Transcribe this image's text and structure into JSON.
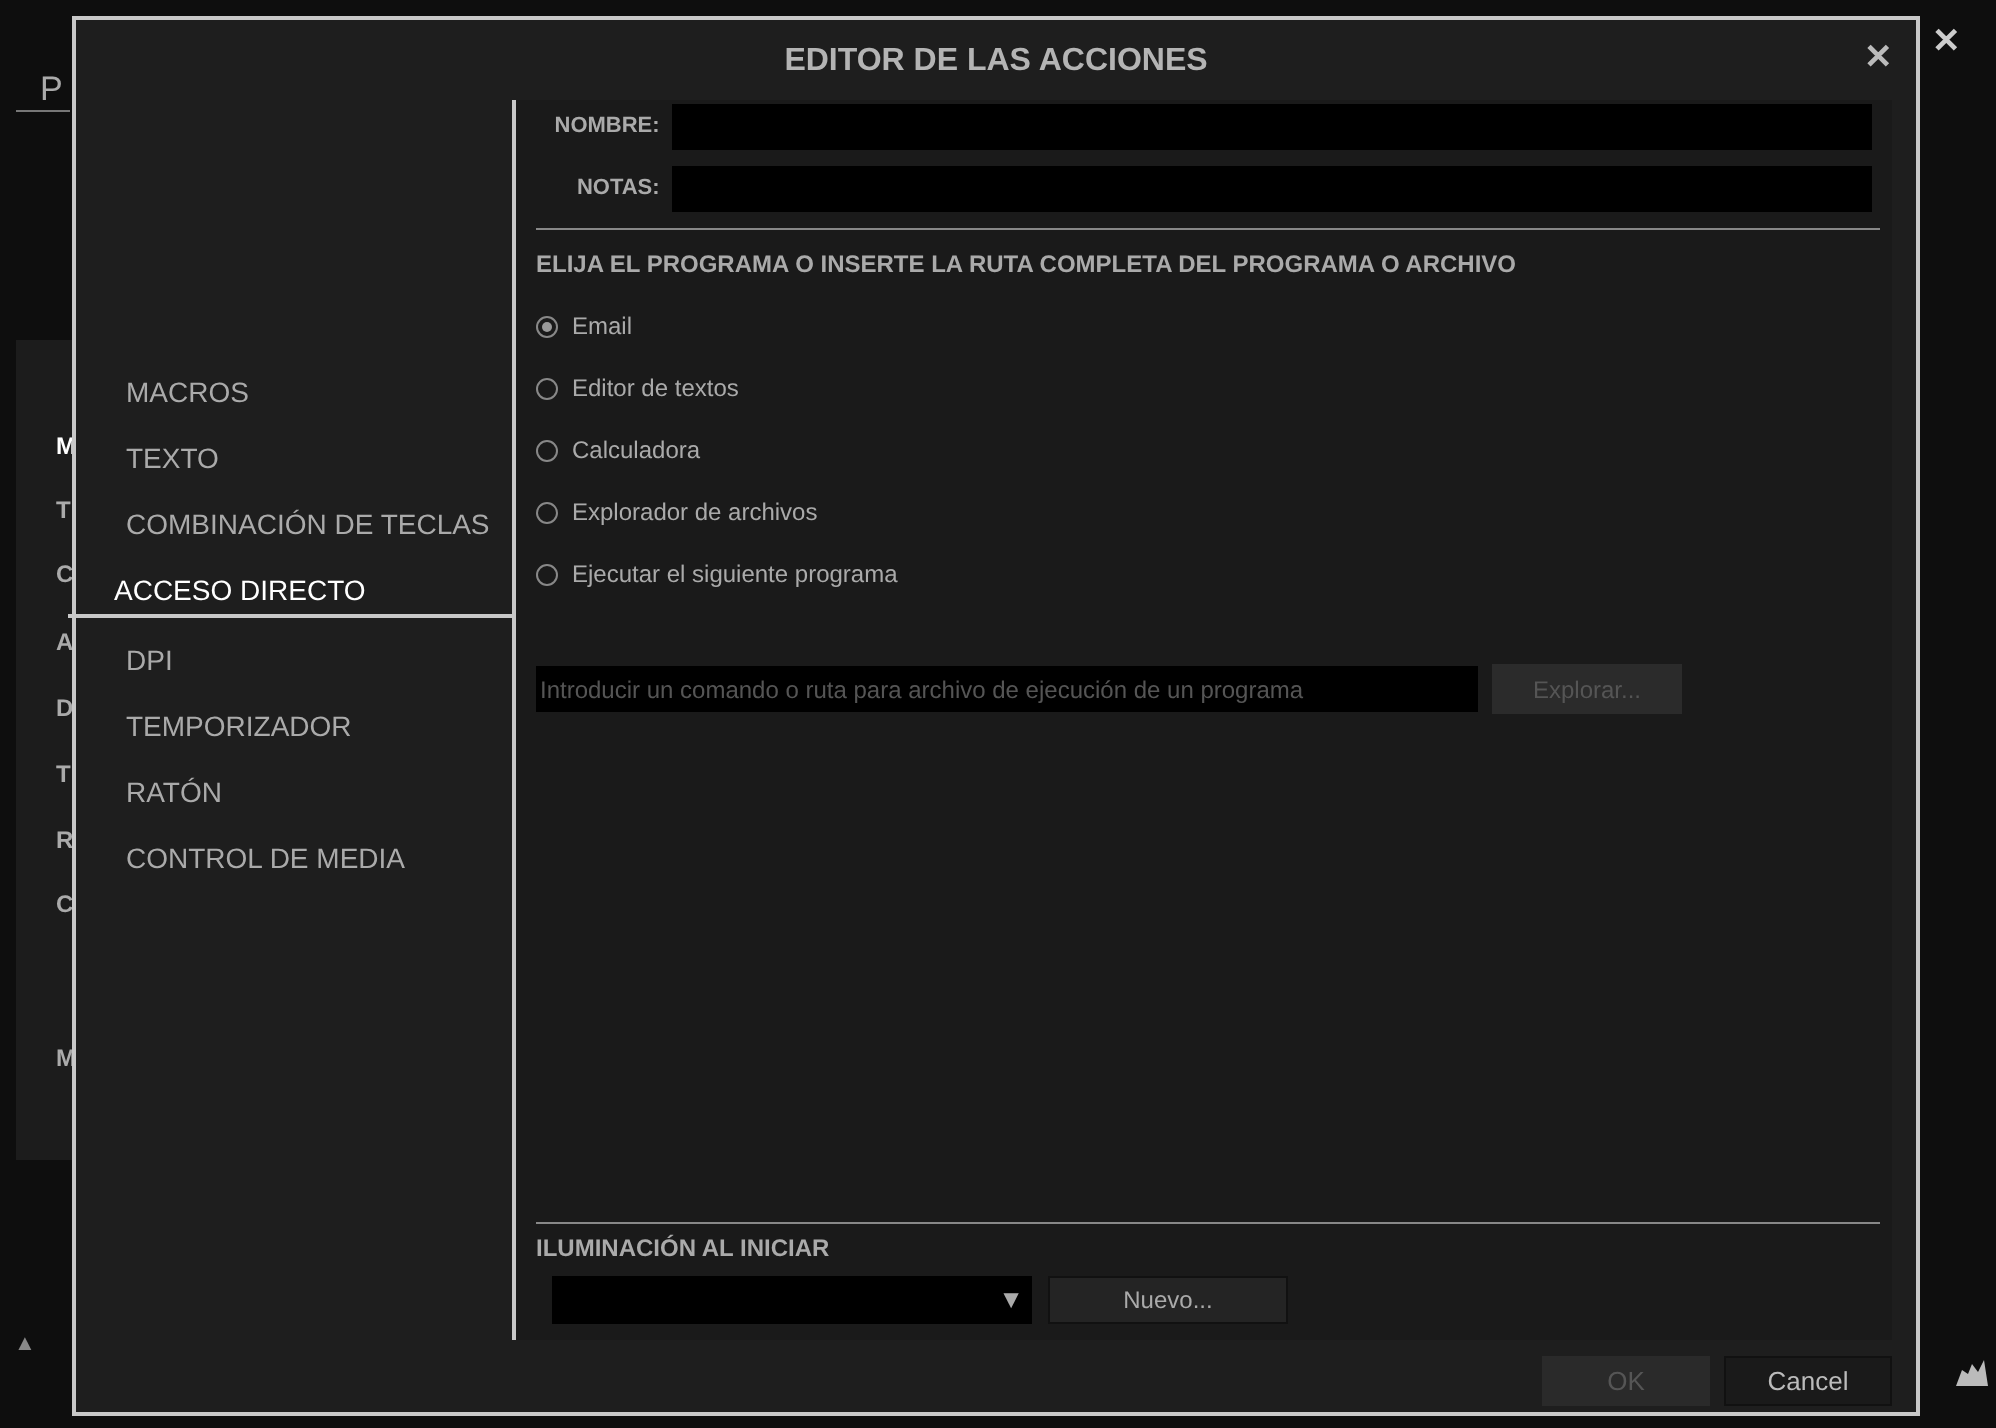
{
  "background": {
    "tab_partial": "P",
    "side_letters": [
      {
        "label": "M",
        "selected": true
      },
      {
        "label": "T",
        "selected": false
      },
      {
        "label": "C",
        "selected": false
      },
      {
        "label": "A",
        "selected": false
      },
      {
        "label": "D",
        "selected": false
      },
      {
        "label": "T",
        "selected": false
      },
      {
        "label": "R",
        "selected": false
      },
      {
        "label": "C",
        "selected": false
      },
      {
        "label": "M",
        "selected": false
      }
    ],
    "close": "✕",
    "up_arrow": "▲"
  },
  "dialog": {
    "title": "EDITOR DE LAS ACCIONES",
    "close": "✕",
    "nav": [
      {
        "label": "MACROS",
        "selected": false
      },
      {
        "label": "TEXTO",
        "selected": false
      },
      {
        "label": "COMBINACIÓN DE TECLAS",
        "selected": false
      },
      {
        "label": "ACCESO DIRECTO",
        "selected": true
      },
      {
        "label": "DPI",
        "selected": false
      },
      {
        "label": "TEMPORIZADOR",
        "selected": false
      },
      {
        "label": "RATÓN",
        "selected": false
      },
      {
        "label": "CONTROL DE MEDIA",
        "selected": false
      }
    ],
    "fields": [
      {
        "label": "NOMBRE:"
      },
      {
        "label": "NOTAS:"
      }
    ],
    "program_heading": "ELIJA EL PROGRAMA O INSERTE LA RUTA COMPLETA DEL PROGRAMA O ARCHIVO",
    "options": [
      {
        "label": "Email",
        "selected": true
      },
      {
        "label": "Editor de textos",
        "selected": false
      },
      {
        "label": "Calculadora",
        "selected": false
      },
      {
        "label": "Explorador de archivos",
        "selected": false
      },
      {
        "label": "Ejecutar el siguiente programa",
        "selected": false
      }
    ],
    "command_field": {
      "placeholder": "Introducir un comando o ruta para archivo de ejecución de un programa"
    },
    "browse_button": {
      "label": "Explorar...",
      "disabled": true
    },
    "lighting": {
      "label": "ILUMINACIÓN AL INICIAR",
      "dropdown_arrow": "▼",
      "new_button": "Nuevo..."
    },
    "buttons": [
      {
        "label": "OK",
        "disabled": true
      },
      {
        "label": "Cancel",
        "disabled": false
      }
    ]
  }
}
